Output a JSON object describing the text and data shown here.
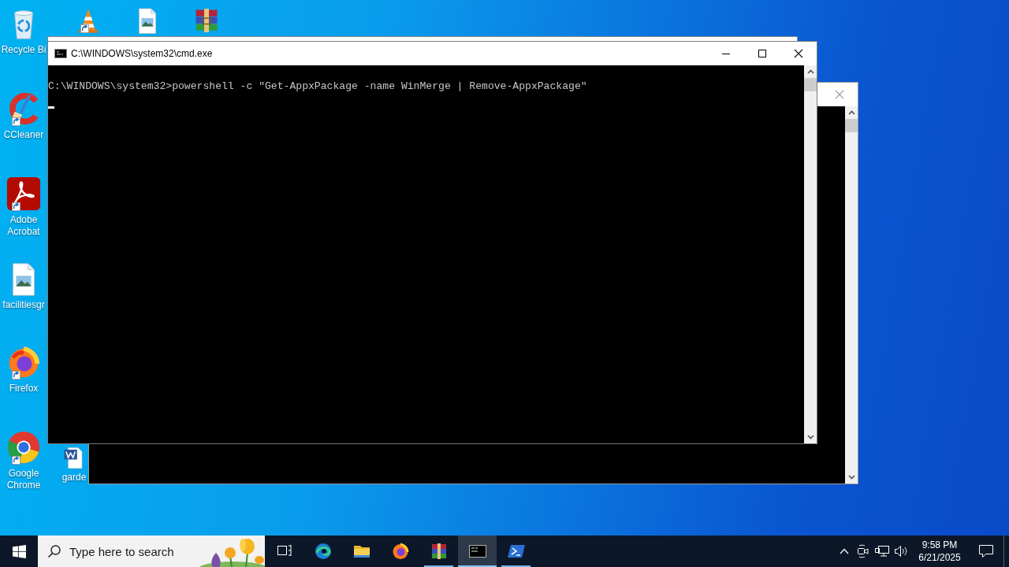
{
  "desktop_icons": [
    {
      "kind": "recycle-bin",
      "label": "Recycle Bi",
      "shortcut": false
    },
    {
      "kind": "cone",
      "shortcut": true
    },
    {
      "kind": "image-file",
      "shortcut": false
    },
    {
      "kind": "archive",
      "shortcut": false
    },
    {
      "kind": "ccleaner",
      "label": "CCleaner",
      "shortcut": true
    },
    {
      "kind": "acrobat",
      "label": "Adobe Acrobat",
      "shortcut": true
    },
    {
      "kind": "image-file",
      "label": "facilitiesgr",
      "shortcut": false
    },
    {
      "kind": "firefox",
      "label": "Firefox",
      "shortcut": true
    },
    {
      "kind": "chrome",
      "label": "Google Chrome",
      "shortcut": true
    },
    {
      "kind": "word-doc",
      "label": "garde",
      "shortcut": false
    }
  ],
  "back_windows": [
    {
      "kind": "blank"
    },
    {
      "kind": "console"
    }
  ],
  "cmd_window": {
    "title": "C:\\WINDOWS\\system32\\cmd.exe",
    "lines": [
      "C:\\WINDOWS\\system32>powershell -c \"Get-AppxPackage -name WinMerge | Remove-AppxPackage\""
    ],
    "cursor": true
  },
  "taskbar": {
    "search": {
      "placeholder": "Type here to search"
    },
    "apps": [
      {
        "kind": "task-view",
        "open": false,
        "selected": false
      },
      {
        "kind": "edge",
        "open": false,
        "selected": false
      },
      {
        "kind": "explorer",
        "open": false,
        "selected": false
      },
      {
        "kind": "firefox",
        "open": false,
        "selected": false
      },
      {
        "kind": "archive",
        "open": true,
        "selected": false
      },
      {
        "kind": "cmd",
        "open": true,
        "selected": true
      },
      {
        "kind": "powershell",
        "open": true,
        "selected": false
      }
    ],
    "clock": {
      "time": "9:58 PM",
      "date": "6/21/2025"
    }
  }
}
